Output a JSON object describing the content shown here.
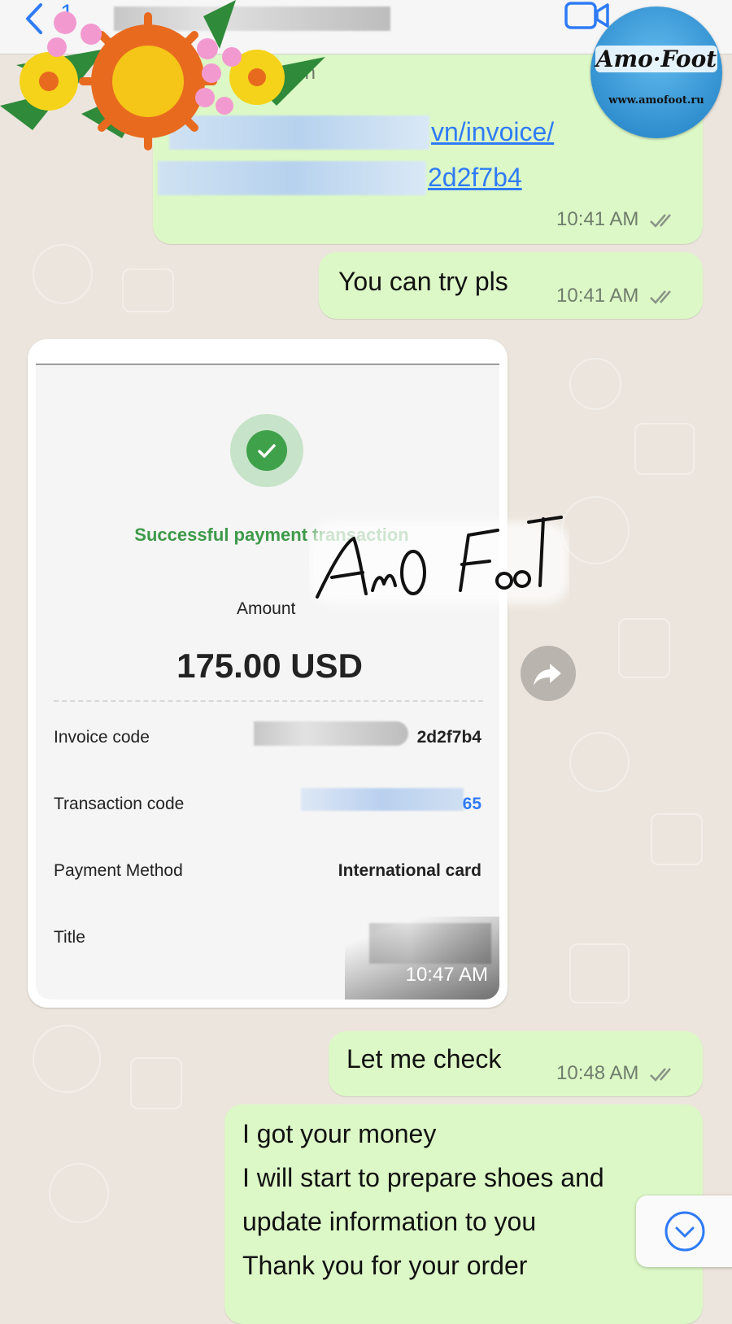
{
  "header": {
    "back_count": "1"
  },
  "messages": [
    {
      "link_domain_tail": ".vn",
      "link_line_1": "vn/invoice/",
      "link_line_2": "2d2f7b4",
      "time": "10:41 AM"
    },
    {
      "text": "You can try pls",
      "time": "10:41 AM"
    },
    {
      "time": "10:48 AM",
      "text": "Let  me check"
    },
    {
      "lines": [
        "I got your money",
        "I will start to prepare shoes and",
        "update information to you",
        "Thank you for your order"
      ]
    }
  ],
  "image_message": {
    "time": "10:47 AM",
    "receipt": {
      "status": "Successful payment transaction",
      "amount_label": "Amount",
      "amount": "175.00 USD",
      "rows": [
        {
          "label": "Invoice code",
          "value": "2d2f7b4"
        },
        {
          "label": "Transaction code",
          "value": "65"
        },
        {
          "label": "Payment Method",
          "value": "International card"
        },
        {
          "label": "Title",
          "value": ""
        }
      ]
    }
  },
  "overlays": {
    "signature": "AmO FooT",
    "logo_title": "Amo·Foot",
    "logo_url": "www.amofoot.ru"
  },
  "colors": {
    "accent": "#2f7bf6",
    "outgoing_bubble": "#dcf8c6",
    "chat_background": "#ece5dd",
    "success_green": "#3d9a49"
  },
  "icons": [
    "back-icon",
    "video-call-icon",
    "double-check-icon",
    "check-icon",
    "forward-icon",
    "chevron-down-icon"
  ]
}
